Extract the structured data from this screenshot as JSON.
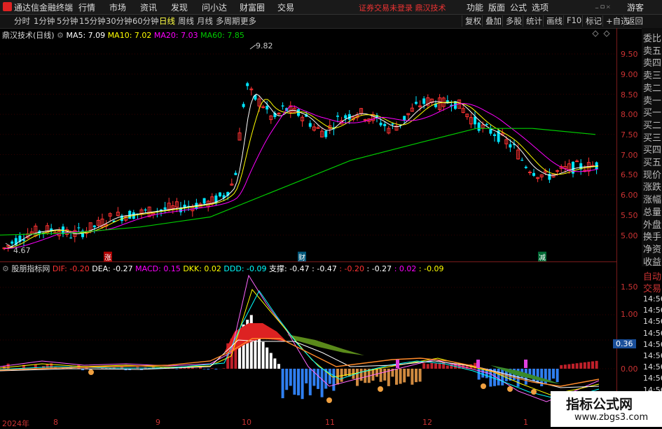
{
  "app": {
    "name": "通达信金融终端"
  },
  "top_menu": [
    "行情",
    "市场",
    "资讯",
    "发现",
    "问小达",
    "财富圈",
    "交易"
  ],
  "notice": "证券交易未登录  鼎汉技术",
  "right_menu": [
    "功能",
    "版面",
    "公式",
    "选项"
  ],
  "guest": "游客",
  "periods": [
    "分时",
    "1分钟",
    "5分钟",
    "15分钟",
    "30分钟",
    "60分钟",
    "日线",
    "周线",
    "月线",
    "多周期",
    "更多"
  ],
  "active_period": "日线",
  "toolbar_buttons": [
    "复权",
    "叠加",
    "多股",
    "统计",
    "画线",
    "F10",
    "标记",
    "+自选",
    "返回"
  ],
  "main_legend": {
    "title": "鼎汉技术(日线)",
    "ma5": "MA5: 7.09",
    "ma10": "MA10: 7.02",
    "ma20": "MA20: 7.03",
    "ma60": "MA60: 7.85"
  },
  "price_axis": [
    "9.50",
    "9.00",
    "8.50",
    "8.00",
    "7.50",
    "7.00",
    "6.50",
    "6.00",
    "5.50",
    "5.00"
  ],
  "price_high": "9.82",
  "price_low": "4.67",
  "events": {
    "zhang": "涨",
    "cai": "财",
    "jian": "减"
  },
  "side_panel": [
    "委比",
    "卖五",
    "卖四",
    "卖三",
    "卖二",
    "卖一",
    "买一",
    "买二",
    "买三",
    "买四",
    "买五",
    "现价",
    "涨跌",
    "涨幅",
    "总量",
    "外盘",
    "换手",
    "净资",
    "收益"
  ],
  "side_panel2": [
    "自动",
    "交易"
  ],
  "side_times": [
    "14:56",
    "14:56",
    "14:56",
    "14:56",
    "14:56",
    "14:56",
    "14:56",
    "14:56",
    "14:56",
    "14:56"
  ],
  "sub_legend": {
    "title": "股朋指标网",
    "dif": "DIF: -0.20",
    "dea": "DEA: -0.27",
    "macd": "MACD: 0.15",
    "dkk": "DKK: 0.02",
    "ddd": "DDD: -0.09",
    "zhicheng": "支撑: -0.47",
    "v1": ": -0.47",
    "v2": ": -0.20",
    "v3": ": -0.27",
    "v4": ": 0.02",
    "v5": ": -0.09"
  },
  "sub_axis": [
    "1.50",
    "1.00",
    "0.36",
    "0.00"
  ],
  "x_axis": [
    "2024年",
    "8",
    "9",
    "10",
    "11",
    "12",
    "1"
  ],
  "watermark": {
    "line1": "指标公式网",
    "line2": "www.zbgs3.com"
  },
  "colors": {
    "up": "#ff3333",
    "down": "#00ffff",
    "ma5": "#ffffff",
    "ma10": "#ffff00",
    "ma20": "#ff00ff",
    "ma60": "#00cc00"
  }
}
